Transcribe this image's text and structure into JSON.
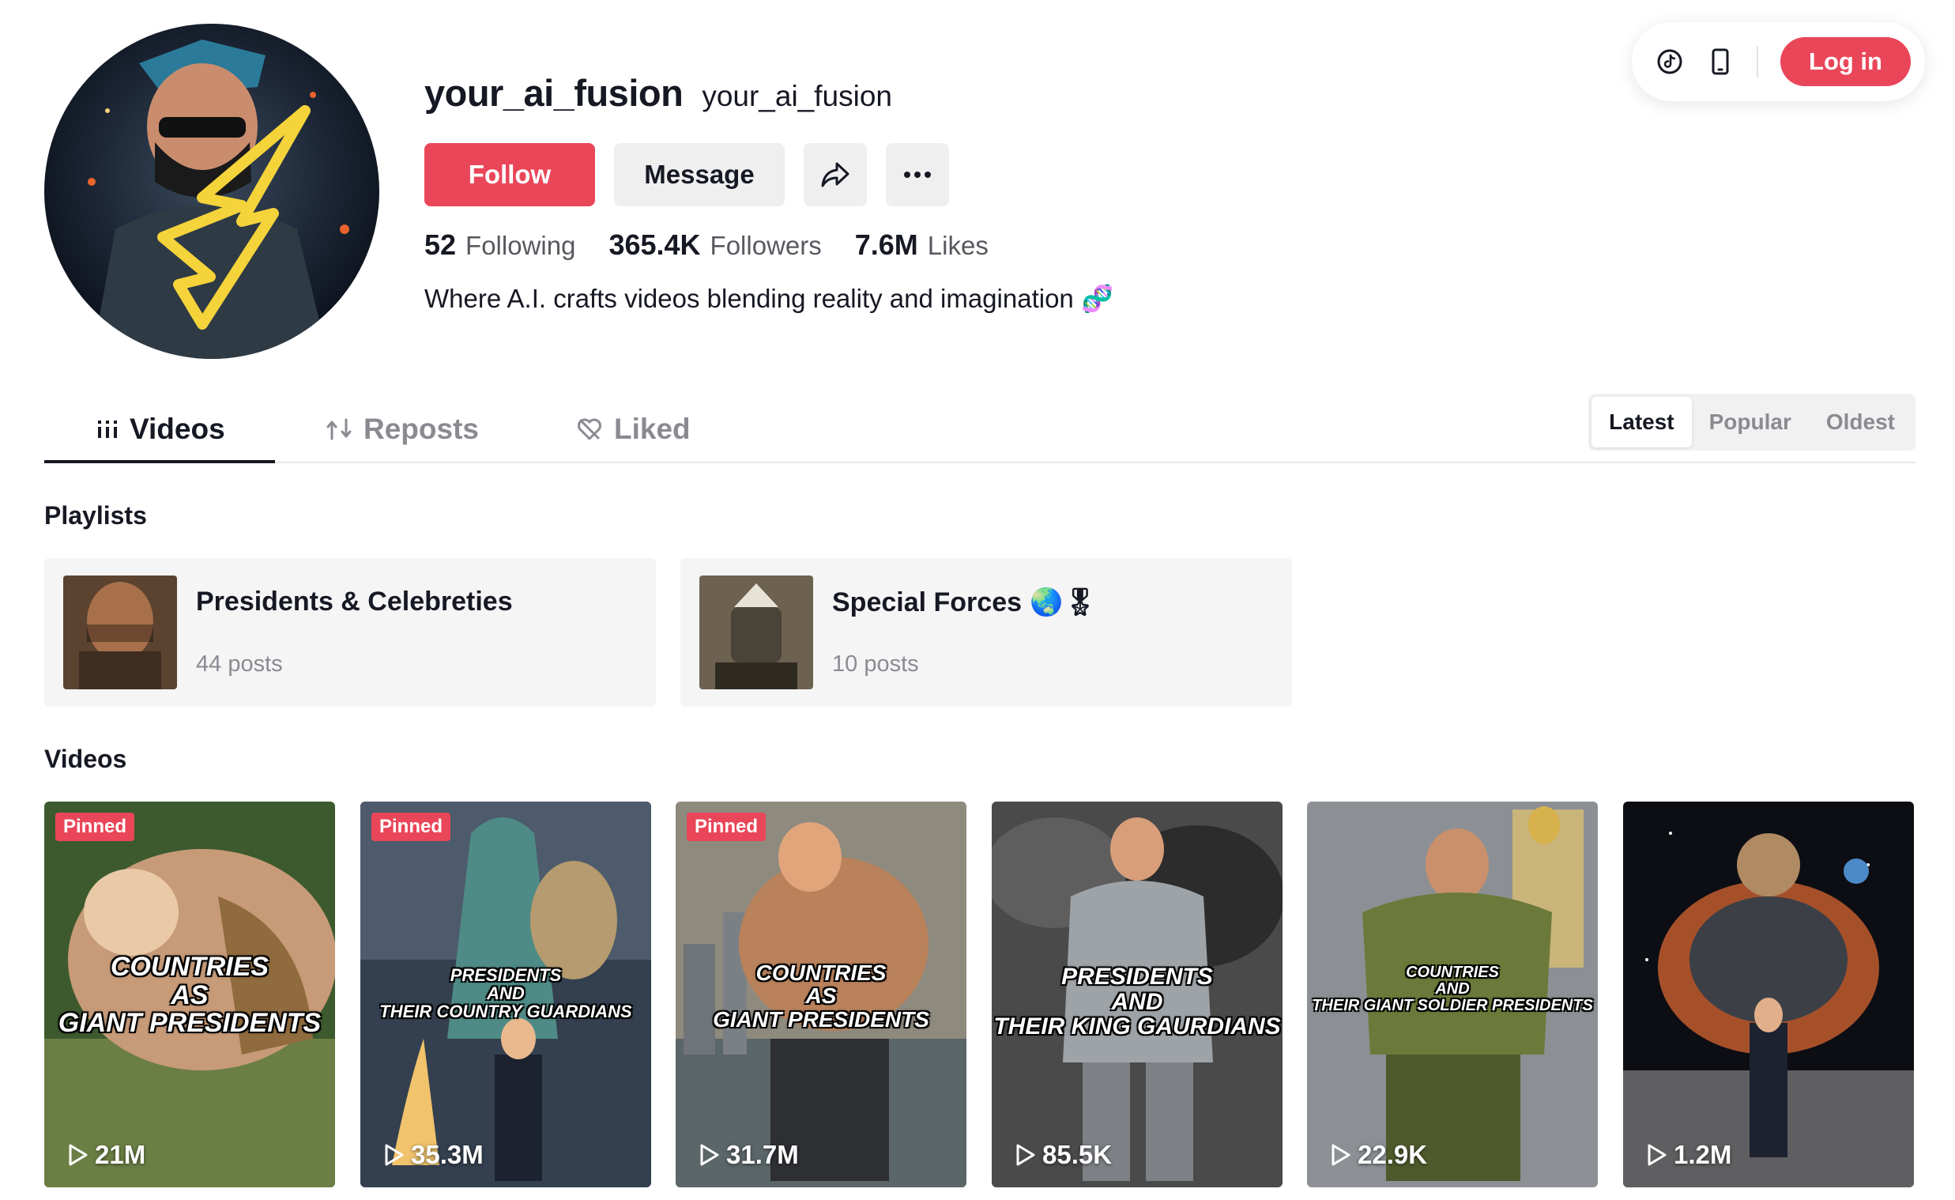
{
  "topbar": {
    "login_label": "Log in"
  },
  "profile": {
    "username": "your_ai_fusion",
    "nickname": "your_ai_fusion",
    "follow_label": "Follow",
    "message_label": "Message",
    "bio": "Where A.I. crafts videos blending reality and imagination 🧬",
    "stats": [
      {
        "value": "52",
        "label": "Following"
      },
      {
        "value": "365.4K",
        "label": "Followers"
      },
      {
        "value": "7.6M",
        "label": "Likes"
      }
    ]
  },
  "tabs": [
    {
      "label": "Videos",
      "icon": "grid-bars-icon",
      "active": true
    },
    {
      "label": "Reposts",
      "icon": "repost-icon",
      "active": false
    },
    {
      "label": "Liked",
      "icon": "heart-slash-icon",
      "active": false
    }
  ],
  "sort": {
    "options": [
      "Latest",
      "Popular",
      "Oldest"
    ],
    "active": "Latest"
  },
  "sections": {
    "playlists": "Playlists",
    "videos": "Videos"
  },
  "playlists": [
    {
      "name": "Presidents & Celebreties",
      "emoji": "",
      "count": "44 posts"
    },
    {
      "name": "Special Forces",
      "emoji": "🌏🎖",
      "count": "10 posts"
    }
  ],
  "videos": [
    {
      "pinned": "Pinned",
      "title_lines": [
        "Countries",
        "as",
        "Giant Presidents"
      ],
      "views": "21M"
    },
    {
      "pinned": "Pinned",
      "title_lines": [
        "Presidents",
        "and",
        "their country guardians"
      ],
      "views": "35.3M"
    },
    {
      "pinned": "Pinned",
      "title_lines": [
        "Countries",
        "as",
        "Giant Presidents"
      ],
      "views": "31.7M"
    },
    {
      "pinned": "",
      "title_lines": [
        "Presidents",
        "and",
        "their king gaurdians"
      ],
      "views": "85.5K"
    },
    {
      "pinned": "",
      "title_lines": [
        "Countries",
        "and",
        "their giant soldier presidents"
      ],
      "views": "22.9K"
    },
    {
      "pinned": "",
      "title_lines": [],
      "views": "1.2M"
    }
  ],
  "colors": {
    "accent": "#ea4659",
    "text": "#161823",
    "muted": "#8a8b91"
  }
}
